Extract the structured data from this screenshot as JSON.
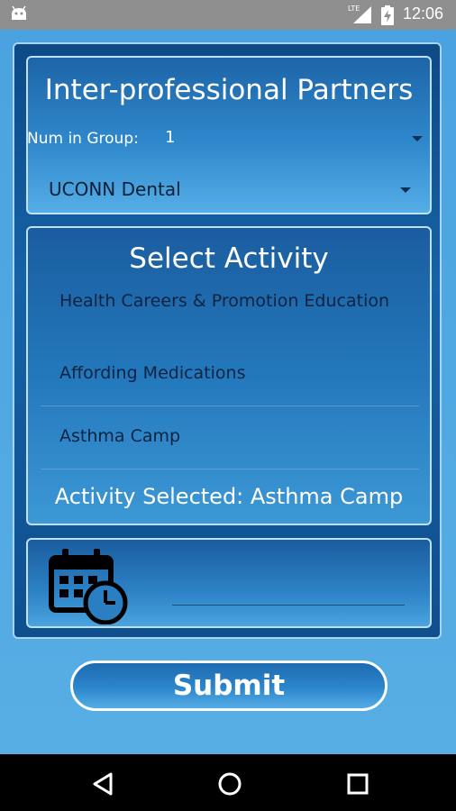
{
  "status_bar": {
    "time": "12:06",
    "network": "LTE",
    "icons": [
      "android-icon",
      "lte-signal-icon",
      "battery-charging-icon"
    ]
  },
  "partners": {
    "title": "Inter-professional Partners",
    "num_label": "Num in Group:",
    "num_value": "1",
    "partner_value": "UCONN Dental"
  },
  "activity": {
    "title": "Select Activity",
    "items": [
      {
        "label": "Health Careers & Promotion Education"
      },
      {
        "label": "Affording Medications"
      },
      {
        "label": "Asthma Camp"
      }
    ],
    "selected_text": "Activity Selected: Asthma Camp"
  },
  "date": {
    "icon": "calendar-clock-icon",
    "value": ""
  },
  "submit_label": "Submit",
  "nav": {
    "icons": [
      "back-icon",
      "home-icon",
      "recent-apps-icon"
    ]
  },
  "colors": {
    "background": "#3d95d6",
    "card_dark": "#0d4a86",
    "panel_border": "#bfe0f7",
    "text_dark": "#0d2340",
    "status_bar": "#8f8f8f"
  }
}
